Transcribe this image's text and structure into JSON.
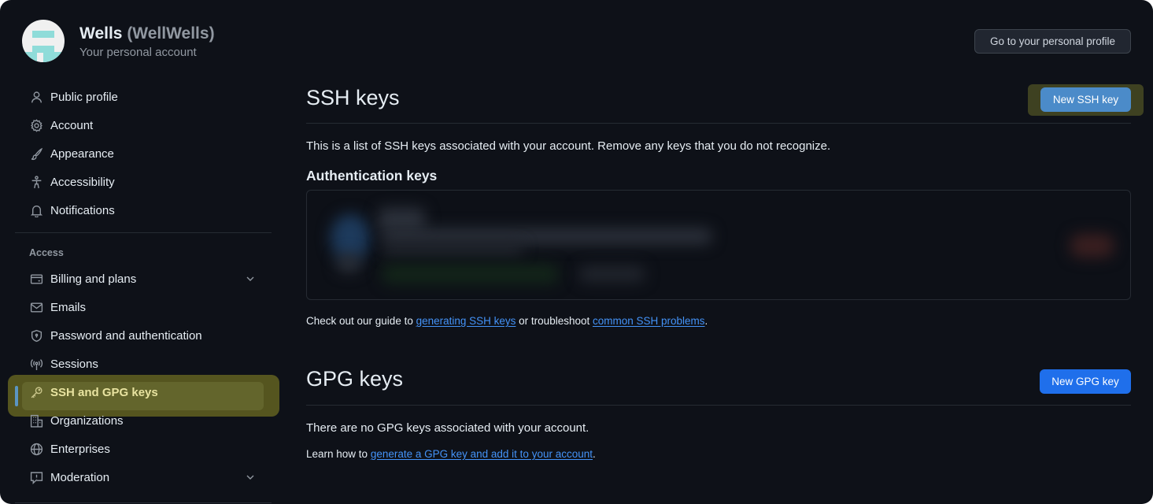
{
  "profile": {
    "display_name": "Wells",
    "handle": "(WellWells)",
    "subtitle": "Your personal account",
    "go_profile_button": "Go to your personal profile"
  },
  "sidebar": {
    "items": [
      {
        "label": "Public profile",
        "icon": "person-icon"
      },
      {
        "label": "Account",
        "icon": "gear-icon"
      },
      {
        "label": "Appearance",
        "icon": "paintbrush-icon"
      },
      {
        "label": "Accessibility",
        "icon": "accessibility-icon"
      },
      {
        "label": "Notifications",
        "icon": "bell-icon"
      }
    ],
    "access_label": "Access",
    "access_items": [
      {
        "label": "Billing and plans",
        "icon": "credit-card-icon",
        "expandable": true
      },
      {
        "label": "Emails",
        "icon": "mail-icon"
      },
      {
        "label": "Password and authentication",
        "icon": "shield-lock-icon"
      },
      {
        "label": "Sessions",
        "icon": "broadcast-icon"
      },
      {
        "label": "SSH and GPG keys",
        "icon": "key-icon",
        "active": true
      },
      {
        "label": "Organizations",
        "icon": "organization-icon"
      },
      {
        "label": "Enterprises",
        "icon": "globe-icon"
      },
      {
        "label": "Moderation",
        "icon": "report-icon",
        "expandable": true
      }
    ]
  },
  "ssh": {
    "title": "SSH keys",
    "new_button": "New SSH key",
    "description": "This is a list of SSH keys associated with your account. Remove any keys that you do not recognize.",
    "auth_keys_title": "Authentication keys",
    "key_entry_redacted": true,
    "help_prefix": "Check out our guide to ",
    "help_link1": "generating SSH keys",
    "help_middle": " or troubleshoot ",
    "help_link2": "common SSH problems",
    "help_suffix": "."
  },
  "gpg": {
    "title": "GPG keys",
    "new_button": "New GPG key",
    "empty_text": "There are no GPG keys associated with your account.",
    "help_prefix": "Learn how to ",
    "help_link": "generate a GPG key and add it to your account",
    "help_suffix": "."
  },
  "colors": {
    "background": "#0e1118",
    "link": "#4493f8",
    "primary_button": "#1f6feb",
    "highlight": "#5a5a20",
    "active_indicator": "#5b95c2"
  }
}
